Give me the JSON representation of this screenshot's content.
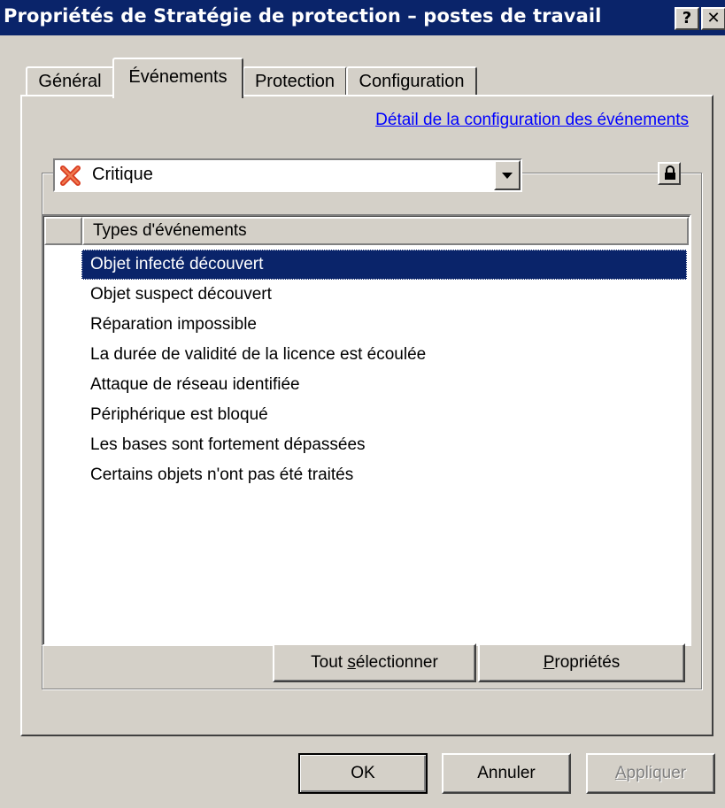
{
  "window": {
    "title": "Propriétés de Stratégie de protection – postes de travail",
    "help_label": "?",
    "close_label": "✕"
  },
  "tabs": [
    {
      "label": "Général",
      "active": false
    },
    {
      "label": "Événements",
      "active": true
    },
    {
      "label": "Protection",
      "active": false
    },
    {
      "label": "Configuration",
      "active": false
    }
  ],
  "events_tab": {
    "config_link": "Détail de la configuration des événements",
    "severity": {
      "selected": "Critique",
      "icon": "red-x-critical-icon"
    },
    "lock_icon": "lock-icon",
    "list": {
      "column_header": "Types d'événements",
      "rows": [
        {
          "label": "Objet infecté découvert",
          "selected": true
        },
        {
          "label": "Objet suspect découvert",
          "selected": false
        },
        {
          "label": "Réparation impossible",
          "selected": false
        },
        {
          "label": "La durée de validité de la licence est écoulée",
          "selected": false
        },
        {
          "label": "Attaque de réseau identifiée",
          "selected": false
        },
        {
          "label": "Périphérique est bloqué",
          "selected": false
        },
        {
          "label": "Les bases sont fortement dépassées",
          "selected": false
        },
        {
          "label": "Certains objets n'ont pas été traités",
          "selected": false
        }
      ]
    },
    "select_all_button": {
      "pre": "Tout ",
      "accel": "s",
      "post": "électionner"
    },
    "properties_button": {
      "pre": "",
      "accel": "P",
      "post": "ropriétés"
    }
  },
  "footer": {
    "ok_label": "OK",
    "cancel_label": "Annuler",
    "apply_button": {
      "pre": "",
      "accel": "A",
      "post": "ppliquer",
      "enabled": false
    }
  },
  "colors": {
    "titlebar": "#0a246a",
    "selection": "#0a246a",
    "link": "#0000ff",
    "face": "#d4d0c8"
  }
}
